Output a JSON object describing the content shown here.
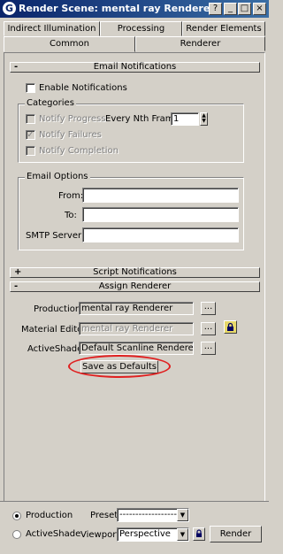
{
  "window": {
    "title": "Render Scene: mental ray Renderer",
    "icon_glyph": "G",
    "help_glyph": "?",
    "minimize_glyph": "_",
    "maximize_glyph": "□",
    "close_glyph": "×"
  },
  "tabs": {
    "row1": [
      "Indirect Illumination",
      "Processing",
      "Render Elements"
    ],
    "row2": [
      "Common",
      "Renderer"
    ]
  },
  "email": {
    "rollout_title": "Email Notifications",
    "rollout_sign": "-",
    "enable_label": "Enable Notifications",
    "categories_label": "Categories",
    "notify_progress": "Notify Progress",
    "notify_failures": "Notify Failures",
    "notify_completion": "Notify Completion",
    "every_nth_label": "Every Nth Frame:",
    "every_nth_value": "1",
    "email_options_label": "Email Options",
    "from_label": "From:",
    "to_label": "To:",
    "smtp_label": "SMTP Server:",
    "from_value": "",
    "to_value": "",
    "smtp_value": ""
  },
  "script": {
    "rollout_title": "Script Notifications",
    "rollout_sign": "+"
  },
  "assign": {
    "rollout_title": "Assign Renderer",
    "rollout_sign": "-",
    "production_label": "Production:",
    "production_value": "mental ray Renderer",
    "material_label": "Material Editor:",
    "material_value": "mental ray Renderer",
    "activeshade_label": "ActiveShade:",
    "activeshade_value": "Default Scanline Renderer",
    "browse_label": "...",
    "save_defaults_label": "Save as Defaults"
  },
  "bottom": {
    "production_label": "Production",
    "activeshade_label": "ActiveShade",
    "preset_label": "Preset:",
    "preset_value": "-------------------",
    "viewport_label": "Viewport:",
    "viewport_value": "Perspective",
    "render_label": "Render",
    "dropdown_glyph": "▼"
  }
}
